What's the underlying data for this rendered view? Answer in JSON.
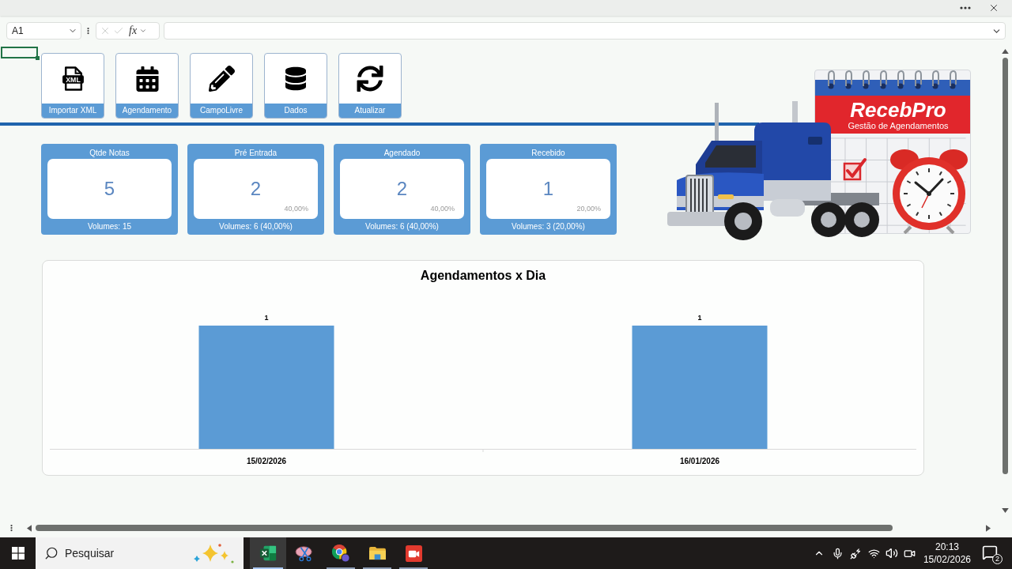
{
  "formula_bar": {
    "name_box": "A1",
    "function_label": "fx"
  },
  "toolbar_buttons": [
    {
      "label": "Importar XML",
      "kind": "xml",
      "badge": "XML"
    },
    {
      "label": "Agendamento",
      "kind": "calendar"
    },
    {
      "label": "CampoLivre",
      "kind": "pencil"
    },
    {
      "label": "Dados",
      "kind": "database"
    },
    {
      "label": "Atualizar",
      "kind": "refresh"
    }
  ],
  "kpi_cards": [
    {
      "title": "Qtde Notas",
      "value": "5",
      "footer": "Volumes: 15"
    },
    {
      "title": "Pré Entrada",
      "value": "2",
      "share": "40,00%",
      "footer": "Volumes: 6 (40,00%)"
    },
    {
      "title": "Agendado",
      "value": "2",
      "share": "40,00%",
      "footer": "Volumes: 6 (40,00%)"
    },
    {
      "title": "Recebido",
      "value": "1",
      "share": "20,00%",
      "footer": "Volumes: 3 (20,00%)"
    }
  ],
  "logo": {
    "title": "RecebPro",
    "subtitle": "Gestão de Agendamentos"
  },
  "chart": {
    "chart_data": {
      "type": "bar",
      "title": "Agendamentos x Dia",
      "categories": [
        "15/02/2026",
        "16/01/2026"
      ],
      "values": [
        1,
        1
      ],
      "data_labels": true
    }
  },
  "taskbar": {
    "search": {
      "placeholder": "Pesquisar"
    },
    "apps": [
      {
        "kind": "spreadsheet",
        "selected": true,
        "running": true
      },
      {
        "kind": "snipping",
        "selected": false,
        "running": false
      },
      {
        "kind": "browser",
        "selected": false,
        "running": true
      },
      {
        "kind": "folder",
        "selected": false,
        "running": true
      },
      {
        "kind": "recorder",
        "selected": false,
        "running": true
      }
    ],
    "clock": {
      "time": "20:13",
      "date": "15/02/2026"
    },
    "notification_count": "2"
  }
}
